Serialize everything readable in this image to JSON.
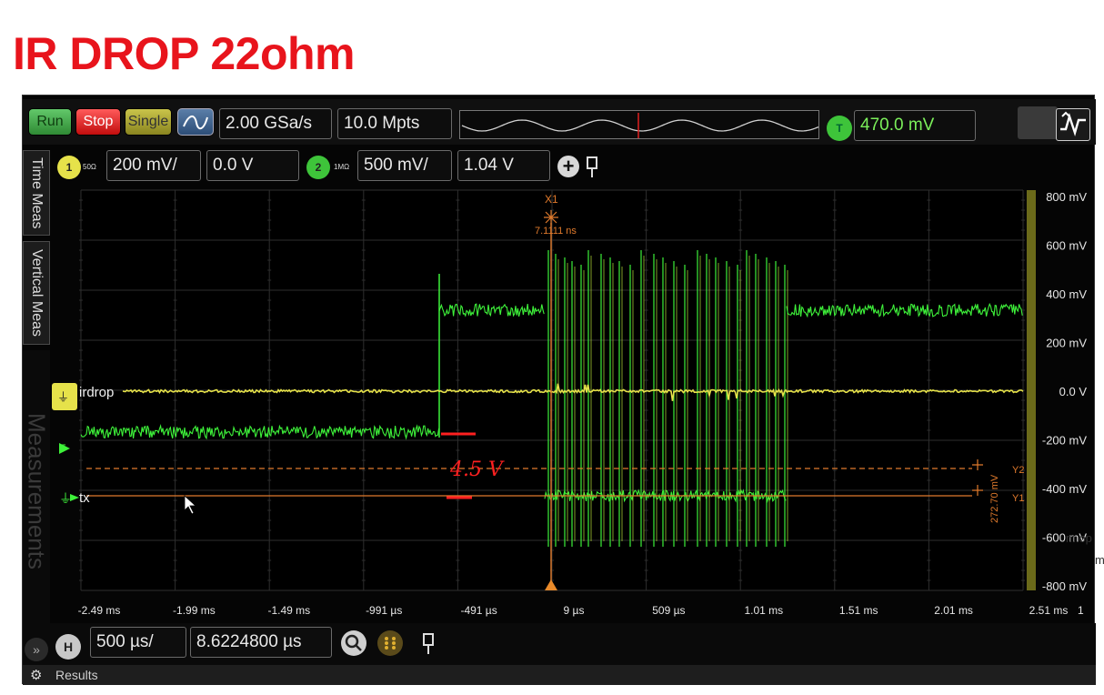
{
  "slide": {
    "title": "IR DROP 22ohm"
  },
  "toolbar": {
    "run_label": "Run",
    "stop_label": "Stop",
    "single_label": "Single",
    "sample_rate": "2.00 GSa/s",
    "memory_depth": "10.0 Mpts",
    "trigger_badge": "T",
    "trigger_level": "470.0 mV"
  },
  "channels": [
    {
      "number": "1",
      "impedance": "50Ω",
      "scale": "200 mV/",
      "offset": "0.0 V",
      "color": "#e6e24a"
    },
    {
      "number": "2",
      "impedance": "1MΩ",
      "scale": "500 mV/",
      "offset": "1.04 V",
      "color": "#3ec43a"
    }
  ],
  "side_tabs": {
    "time_meas": "Time Meas",
    "vertical_meas": "Vertical Meas",
    "measurements": "Measurements"
  },
  "plot": {
    "trace_labels": {
      "ch1": "irdrop",
      "ch2": "tx"
    },
    "cursor_x1": {
      "label": "X1",
      "value": "7.1111 ns"
    },
    "cursor_y": {
      "y2": "Y2",
      "y1": "Y1",
      "delta": "272.70 mV"
    },
    "annotation": "4.5 V",
    "y_ticks": [
      "800 mV",
      "600 mV",
      "400 mV",
      "200 mV",
      "0.0 V",
      "-200 mV",
      "-400 mV",
      "-600 mV",
      "-800 mV"
    ],
    "x_ticks": [
      "-2.49 ms",
      "-1.99 ms",
      "-1.49 ms",
      "-991 µs",
      "-491 µs",
      "9 µs",
      "509 µs",
      "1.01 ms",
      "1.51 ms",
      "2.01 ms",
      "2.51 ms"
    ],
    "page_num": "1",
    "ch1_color": "#e6e24a",
    "ch2_color": "#3ef23a",
    "cursor_color": "#e07a2c"
  },
  "horizontal": {
    "badge": "H",
    "scale": "500 µs/",
    "position": "8.6224800 µs"
  },
  "results": {
    "label": "Results"
  },
  "side_text": {
    "right_a": "m op",
    "right_b": "m"
  }
}
